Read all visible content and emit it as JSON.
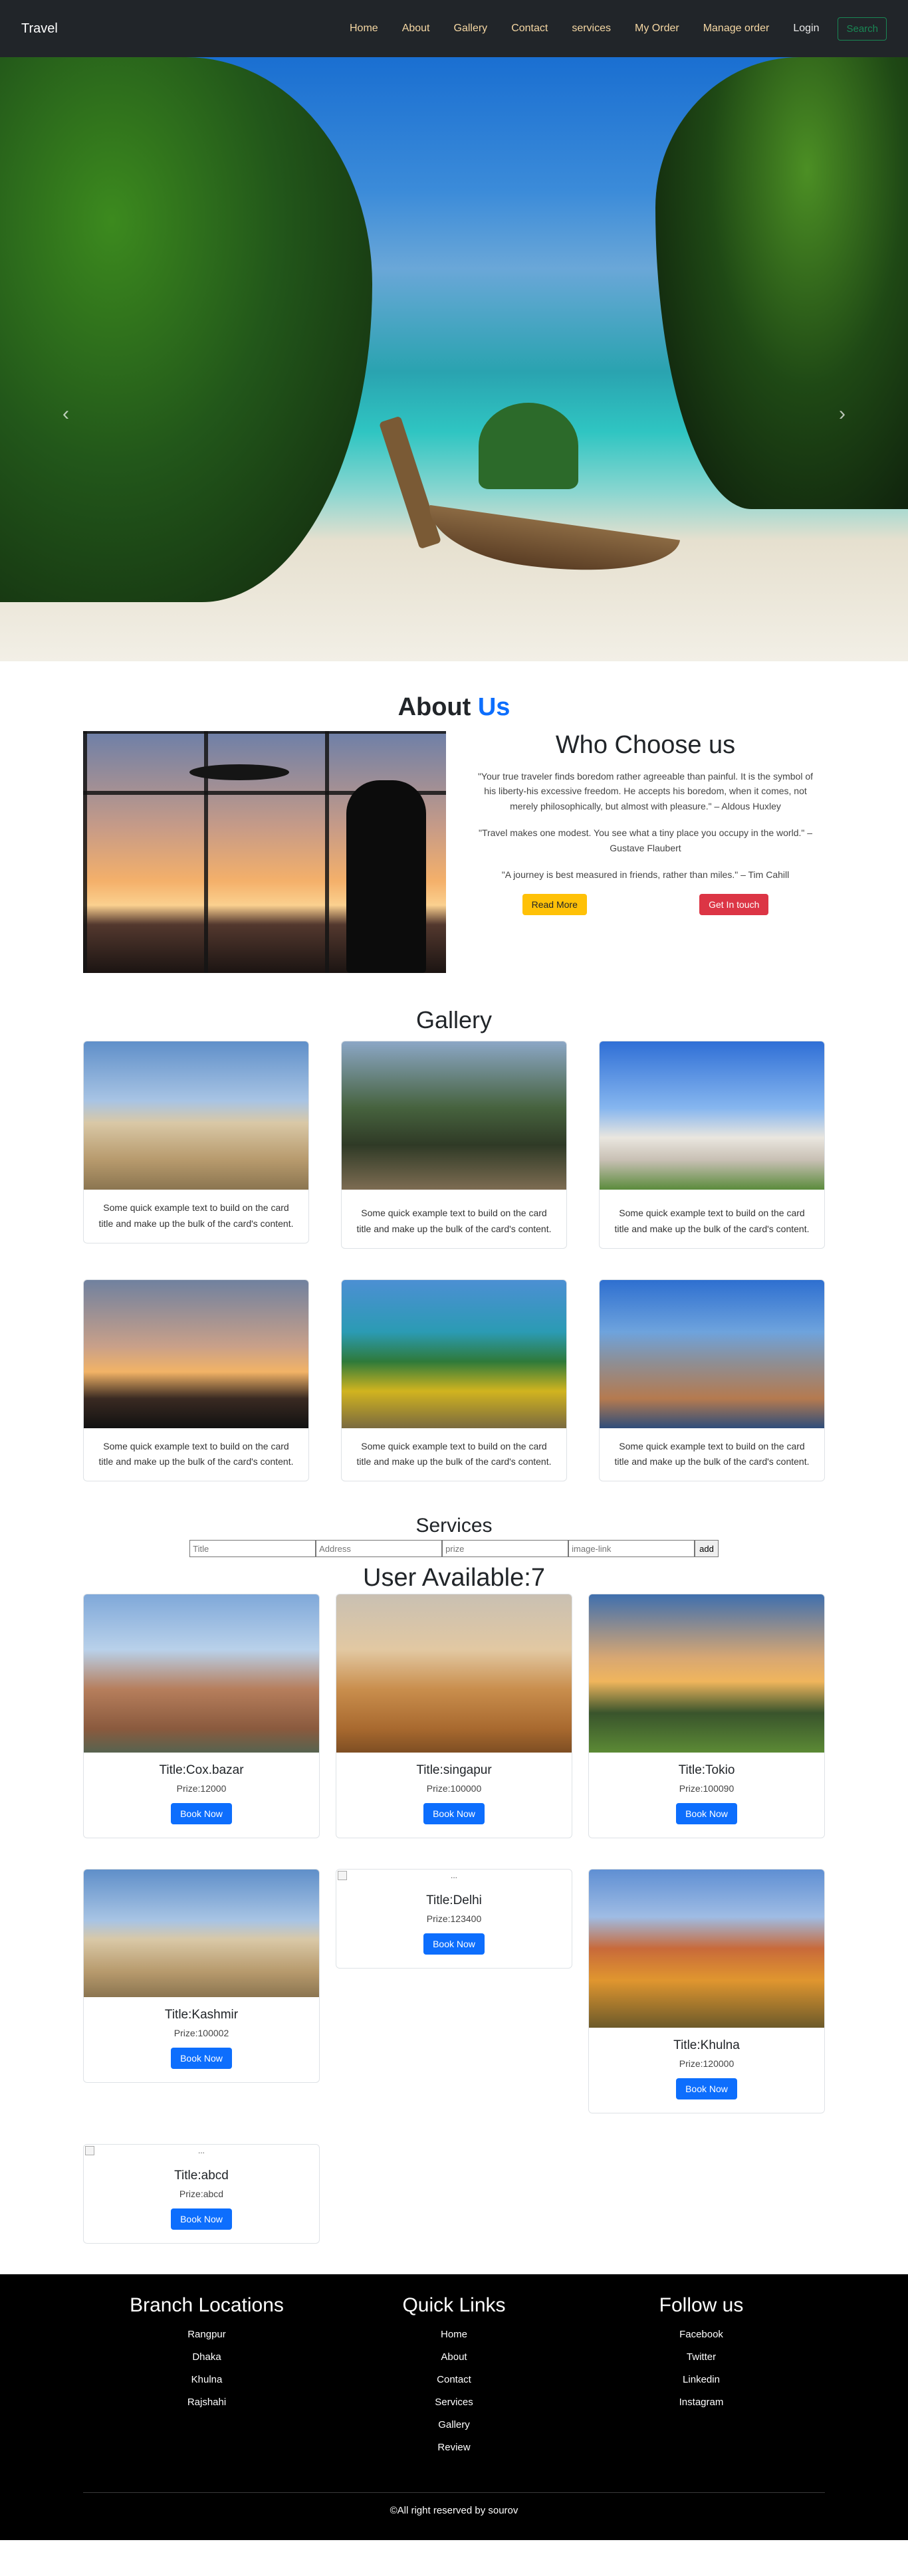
{
  "navbar": {
    "brand": "Travel",
    "links": [
      "Home",
      "About",
      "Gallery",
      "Contact",
      "services",
      "My Order",
      "Manage order",
      "Login"
    ],
    "search_label": "Search"
  },
  "hero": {
    "prev_icon": "chevron-left-icon",
    "next_icon": "chevron-right-icon"
  },
  "about": {
    "title_main": "About",
    "title_accent": "Us",
    "heading": "Who Choose us",
    "quotes": [
      "\"Your true traveler finds boredom rather agreeable than painful. It is the symbol of his liberty-his excessive freedom. He accepts his boredom, when it comes, not merely philosophically, but almost with pleasure.\" – Aldous Huxley",
      "\"Travel makes one modest. You see what a tiny place you occupy in the world.\" – Gustave Flaubert",
      "\"A journey is best measured in friends, rather than miles.\" – Tim Cahill"
    ],
    "read_more": "Read More",
    "get_in_touch": "Get In touch"
  },
  "gallery": {
    "title": "Gallery",
    "cards": [
      "Some quick example text to build on the card title and make up the bulk of the card's content.",
      "Some quick example text to build on the card title and make up the bulk of the card's content.",
      "Some quick example text to build on the card title and make up the bulk of the card's content.",
      "Some quick example text to build on the card title and make up the bulk of the card's content.",
      "Some quick example text to build on the card title and make up the bulk of the card's content.",
      "Some quick example text to build on the card title and make up the bulk of the card's content."
    ]
  },
  "services": {
    "title": "Services",
    "placeholders": {
      "title": "Title",
      "address": "Address",
      "prize": "prize",
      "image": "image-link"
    },
    "add_label": "add",
    "users_title": "User Available:7",
    "book_label": "Book Now",
    "broken_alt": "...",
    "items": [
      {
        "title": "Title:Cox.bazar",
        "prize": "Prize:12000"
      },
      {
        "title": "Title:singapur",
        "prize": "Prize:100000"
      },
      {
        "title": "Title:Tokio",
        "prize": "Prize:100090"
      },
      {
        "title": "Title:Kashmir",
        "prize": "Prize:100002"
      },
      {
        "title": "Title:Delhi",
        "prize": "Prize:123400"
      },
      {
        "title": "Title:Khulna",
        "prize": "Prize:120000"
      },
      {
        "title": "Title:abcd",
        "prize": "Prize:abcd"
      }
    ]
  },
  "footer": {
    "branch_title": "Branch Locations",
    "branches": [
      "Rangpur",
      "Dhaka",
      "Khulna",
      "Rajshahi"
    ],
    "links_title": "Quick Links",
    "links": [
      "Home",
      "About",
      "Contact",
      "Services",
      "Gallery",
      "Review"
    ],
    "follow_title": "Follow us",
    "social": [
      "Facebook",
      "Twitter",
      "Linkedin",
      "Instagram"
    ],
    "copyright": "©All right reserved by sourov"
  }
}
